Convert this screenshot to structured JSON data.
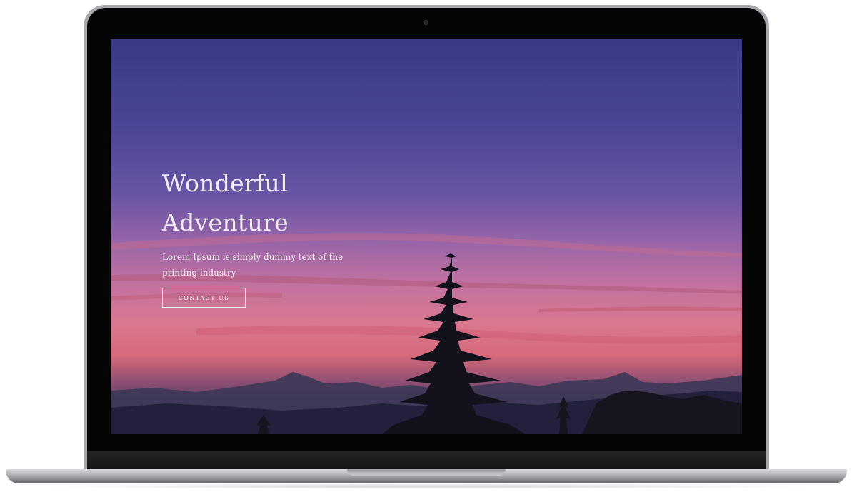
{
  "hero": {
    "title_line1": "Wonderful",
    "title_line2": "Adventure",
    "subtitle": "Lorem Ipsum is simply dummy text of the printing industry",
    "cta_label": "CONTACT US"
  },
  "colors": {
    "sky_top": "#393a88",
    "sky_mid": "#9a66a8",
    "sky_glow": "#d9788f",
    "silhouette": "#12111c",
    "text": "#f1ecf3"
  }
}
